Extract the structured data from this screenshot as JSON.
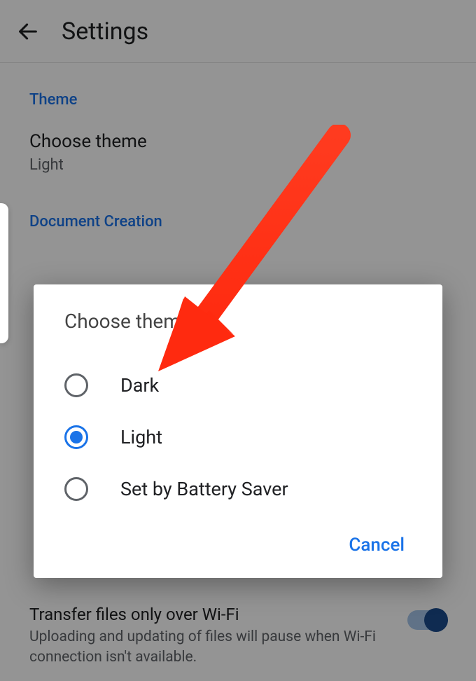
{
  "header": {
    "title": "Settings"
  },
  "sections": {
    "theme": {
      "header": "Theme",
      "choose_label": "Choose theme",
      "current_value": "Light"
    },
    "document_creation": {
      "header": "Document Creation"
    },
    "wifi_transfer": {
      "title": "Transfer files only over Wi-Fi",
      "subtitle": "Uploading and updating of files will pause when Wi-Fi connection isn't available."
    }
  },
  "dialog": {
    "title": "Choose theme",
    "options": [
      {
        "label": "Dark",
        "selected": false
      },
      {
        "label": "Light",
        "selected": true
      },
      {
        "label": "Set by Battery Saver",
        "selected": false
      }
    ],
    "cancel_label": "Cancel"
  },
  "annotation": {
    "color": "#ff3b1f"
  }
}
